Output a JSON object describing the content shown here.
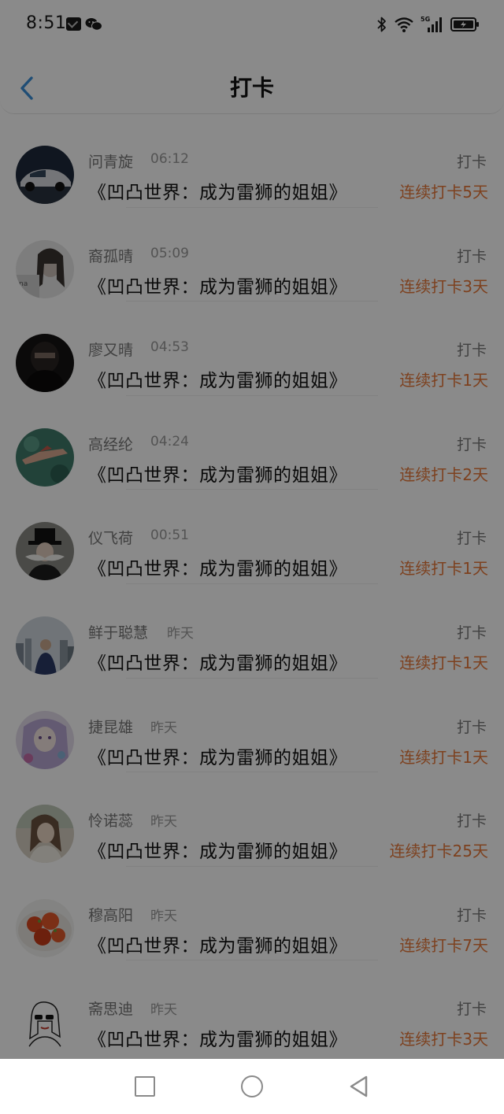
{
  "status_bar": {
    "time": "8:51",
    "icons": [
      "mail-icon",
      "wechat-icon",
      "bluetooth-icon",
      "wifi-icon",
      "5g-signal-icon",
      "battery-icon"
    ],
    "network": "5G"
  },
  "header": {
    "title": "打卡",
    "back_icon": "chevron-left-icon",
    "accent": "#3a8fd8"
  },
  "colors": {
    "streak": "#e8783a"
  },
  "rows": [
    {
      "name": "问青旋",
      "time": "06:12",
      "book": "《凹凸世界：成为雷狮的姐姐》",
      "action": "打卡",
      "streak": "连续打卡5天",
      "avatar": "car-avatar"
    },
    {
      "name": "裔孤晴",
      "time": "05:09",
      "book": "《凹凸世界：成为雷狮的姐姐》",
      "action": "打卡",
      "streak": "连续打卡3天",
      "avatar": "girl-avatar"
    },
    {
      "name": "廖又晴",
      "time": "04:53",
      "book": "《凹凸世界：成为雷狮的姐姐》",
      "action": "打卡",
      "streak": "连续打卡1天",
      "avatar": "dark-figure-avatar"
    },
    {
      "name": "高经纶",
      "time": "04:24",
      "book": "《凹凸世界：成为雷狮的姐姐》",
      "action": "打卡",
      "streak": "连续打卡2天",
      "avatar": "underwater-avatar"
    },
    {
      "name": "仪飞荷",
      "time": "00:51",
      "book": "《凹凸世界：成为雷狮的姐姐》",
      "action": "打卡",
      "streak": "连续打卡1天",
      "avatar": "top-hat-avatar"
    },
    {
      "name": "鲜于聪慧",
      "time": "昨天",
      "book": "《凹凸世界：成为雷狮的姐姐》",
      "action": "打卡",
      "streak": "连续打卡1天",
      "avatar": "city-avatar"
    },
    {
      "name": "捷昆雄",
      "time": "昨天",
      "book": "《凹凸世界：成为雷狮的姐姐》",
      "action": "打卡",
      "streak": "连续打卡1天",
      "avatar": "anime-avatar"
    },
    {
      "name": "怜诺蕊",
      "time": "昨天",
      "book": "《凹凸世界：成为雷狮的姐姐》",
      "action": "打卡",
      "streak": "连续打卡25天",
      "avatar": "portrait-avatar"
    },
    {
      "name": "穆高阳",
      "time": "昨天",
      "book": "《凹凸世界：成为雷狮的姐姐》",
      "action": "打卡",
      "streak": "连续打卡7天",
      "avatar": "food-avatar"
    },
    {
      "name": "斋思迪",
      "time": "昨天",
      "book": "《凹凸世界：成为雷狮的姐姐》",
      "action": "打卡",
      "streak": "连续打卡3天",
      "avatar": "sketch-avatar"
    }
  ],
  "nav_bar": {
    "icons": [
      "recent-apps-square-icon",
      "home-circle-icon",
      "back-triangle-icon"
    ]
  }
}
